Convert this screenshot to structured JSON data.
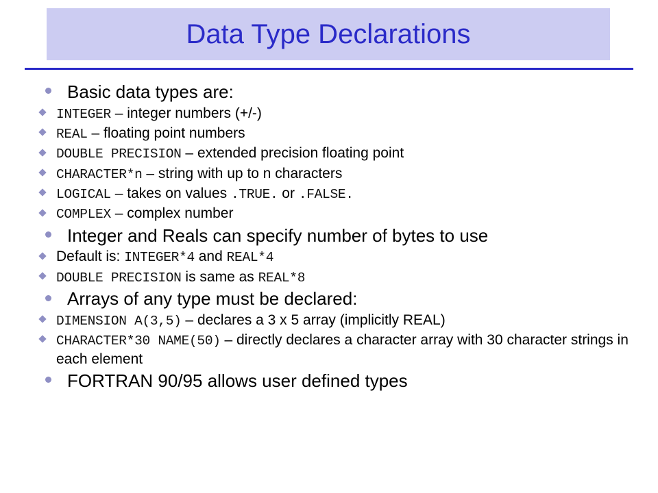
{
  "slide": {
    "title": "Data Type Declarations",
    "colors": {
      "title_text": "#2a2ac8",
      "title_band": "#ccccf2",
      "rule": "#2a2ac8",
      "bullet": "#8f8fc4",
      "body_text": "#000000"
    },
    "bullets": [
      {
        "level": 1,
        "parts": [
          {
            "type": "text",
            "text": "Basic data types are:"
          }
        ]
      },
      {
        "level": 2,
        "parts": [
          {
            "type": "code",
            "text": "INTEGER"
          },
          {
            "type": "text",
            "text": " – integer numbers (+/-)"
          }
        ]
      },
      {
        "level": 2,
        "parts": [
          {
            "type": "code",
            "text": "REAL"
          },
          {
            "type": "text",
            "text": " – floating point numbers"
          }
        ]
      },
      {
        "level": 2,
        "parts": [
          {
            "type": "code",
            "text": "DOUBLE PRECISION"
          },
          {
            "type": "text",
            "text": " – extended precision floating point"
          }
        ]
      },
      {
        "level": 2,
        "parts": [
          {
            "type": "code",
            "text": "CHARACTER*n"
          },
          {
            "type": "text",
            "text": " – string with up to n characters"
          }
        ]
      },
      {
        "level": 2,
        "parts": [
          {
            "type": "code",
            "text": "LOGICAL"
          },
          {
            "type": "text",
            "text": " – takes on values "
          },
          {
            "type": "code",
            "text": ".TRUE."
          },
          {
            "type": "text",
            "text": " or "
          },
          {
            "type": "code",
            "text": ".FALSE."
          }
        ]
      },
      {
        "level": 2,
        "parts": [
          {
            "type": "code",
            "text": "COMPLEX"
          },
          {
            "type": "text",
            "text": " – complex number"
          }
        ]
      },
      {
        "level": 1,
        "parts": [
          {
            "type": "text",
            "text": "Integer and Reals can specify number of bytes to use"
          }
        ]
      },
      {
        "level": 2,
        "parts": [
          {
            "type": "text",
            "text": "Default is: "
          },
          {
            "type": "code",
            "text": "INTEGER*4"
          },
          {
            "type": "text",
            "text": " and "
          },
          {
            "type": "code",
            "text": "REAL*4"
          }
        ]
      },
      {
        "level": 2,
        "parts": [
          {
            "type": "code",
            "text": "DOUBLE PRECISION"
          },
          {
            "type": "text",
            "text": " is same as "
          },
          {
            "type": "code",
            "text": "REAL*8"
          }
        ]
      },
      {
        "level": 1,
        "parts": [
          {
            "type": "text",
            "text": "Arrays of any type must be declared:"
          }
        ]
      },
      {
        "level": 2,
        "parts": [
          {
            "type": "code",
            "text": "DIMENSION A(3,5)"
          },
          {
            "type": "text",
            "text": " – declares a 3 x 5 array (implicitly REAL)"
          }
        ]
      },
      {
        "level": 2,
        "parts": [
          {
            "type": "code",
            "text": "CHARACTER*30 NAME(50)"
          },
          {
            "type": "text",
            "text": " – directly declares a character array with 30 character strings in each element"
          }
        ]
      },
      {
        "level": 1,
        "parts": [
          {
            "type": "text",
            "text": "FORTRAN 90/95 allows user defined types"
          }
        ]
      }
    ]
  }
}
